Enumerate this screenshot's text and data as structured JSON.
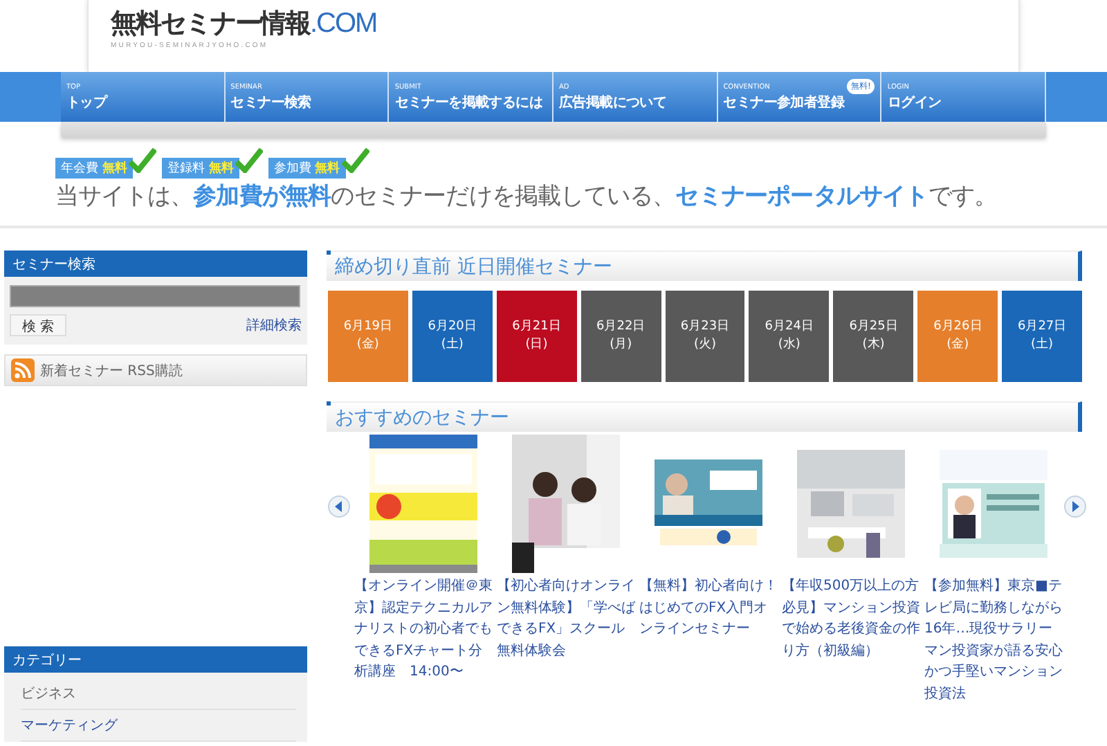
{
  "logo": {
    "name": "無料セミナー情報",
    "suffix": ".COM",
    "subtitle": "MURYOU-SEMINARJYOHO.COM"
  },
  "nav": [
    {
      "en": "TOP",
      "label": "トップ"
    },
    {
      "en": "SEMINAR",
      "label": "セミナー検索"
    },
    {
      "en": "SUBMIT",
      "label": "セミナーを掲載するには"
    },
    {
      "en": "AD",
      "label": "広告掲載について"
    },
    {
      "en": "CONVENTION",
      "label": "セミナー参加者登録",
      "badge": "無料!"
    },
    {
      "en": "LOGIN",
      "label": "ログイン"
    }
  ],
  "banner": {
    "badges": [
      {
        "label": "年会費",
        "value": "無料"
      },
      {
        "label": "登録料",
        "value": "無料"
      },
      {
        "label": "参加費",
        "value": "無料"
      }
    ],
    "tagline": "当サイトは、**参加費が無料**のセミナーだけを掲載している、**セミナーポータルサイト**です。"
  },
  "sidebar": {
    "search": {
      "title": "セミナー検索",
      "button": "検 索",
      "advanced_link": "詳細検索"
    },
    "rss": "新着セミナー RSS購読",
    "categories": {
      "title": "カテゴリー",
      "items": [
        {
          "label": "ビジネス",
          "selected": true
        },
        {
          "label": "マーケティング",
          "selected": false
        }
      ]
    }
  },
  "upcoming": {
    "title": "締め切り直前 近日開催セミナー",
    "days": [
      {
        "date": "6月19日",
        "weekday": "(金)",
        "color": "#e57f2b"
      },
      {
        "date": "6月20日",
        "weekday": "(土)",
        "color": "#1b68b8"
      },
      {
        "date": "6月21日",
        "weekday": "(日)",
        "color": "#bd0b20"
      },
      {
        "date": "6月22日",
        "weekday": "(月)",
        "color": "#595959"
      },
      {
        "date": "6月23日",
        "weekday": "(火)",
        "color": "#595959"
      },
      {
        "date": "6月24日",
        "weekday": "(水)",
        "color": "#595959"
      },
      {
        "date": "6月25日",
        "weekday": "(木)",
        "color": "#595959"
      },
      {
        "date": "6月26日",
        "weekday": "(金)",
        "color": "#e57f2b"
      },
      {
        "date": "6月27日",
        "weekday": "(土)",
        "color": "#1b68b8"
      }
    ]
  },
  "recommended": {
    "title": "おすすめのセミナー",
    "items": [
      {
        "title": "【オンライン開催＠東京】認定テクニカルアナリストの初心者でもできるFXチャート分析講座　14:00〜"
      },
      {
        "title": "【初心者向けオンライン無料体験】「学べばできるFX」スクール無料体験会"
      },
      {
        "title": "【無料】初心者向け！はじめてのFX入門オンラインセミナー"
      },
      {
        "title": "【年収500万以上の方必見】マンション投資で始める老後資金の作り方（初級編）"
      },
      {
        "title": "【参加無料】東京■テレビ局に勤務しながら16年…現役サラリーマン投資家が語る安心かつ手堅いマンション投資法"
      }
    ]
  }
}
